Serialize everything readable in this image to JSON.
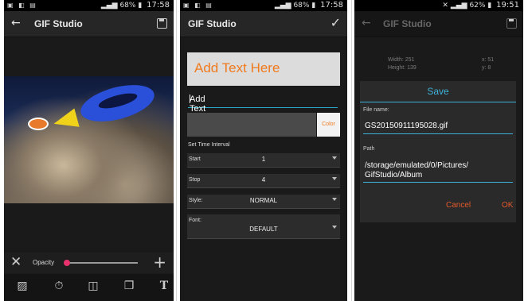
{
  "screen1": {
    "status": {
      "battery": "68%",
      "time": "17:58"
    },
    "title": "GIF Studio",
    "opacity_label": "Opacity",
    "opacity_value": 0.03
  },
  "screen2": {
    "status": {
      "battery": "68%",
      "time": "17:58"
    },
    "title": "GIF Studio",
    "preview_text": "Add Text Here",
    "input_value": "Add Text Here",
    "color_button": "Color",
    "interval_label": "Set Time Interval",
    "rows": [
      {
        "label": "Start",
        "value": "1"
      },
      {
        "label": "Stop",
        "value": "4"
      },
      {
        "label": "Style:",
        "value": "NORMAL"
      },
      {
        "label": "Font:",
        "value": "DEFAULT"
      }
    ]
  },
  "screen3": {
    "status": {
      "battery": "62%",
      "time": "19:51"
    },
    "title": "GIF Studio",
    "bg_info": {
      "width": "Width: 251",
      "height": "Height: 139",
      "x": "x: 51",
      "y": "y: 8"
    },
    "dialog": {
      "title": "Save",
      "file_label": "File name:",
      "file_value": "GS20150911195028.gif",
      "path_label": "Path",
      "path_value_1": "/storage/emulated/0/Pictures/",
      "path_value_2": "GifStudio/Album",
      "cancel": "Cancel",
      "ok": "OK"
    }
  },
  "colors": {
    "accent_blue": "#3fb1d8",
    "accent_orange": "#f07a1e",
    "dialog_button": "#e55a2b",
    "slider_thumb": "#e8326e"
  }
}
